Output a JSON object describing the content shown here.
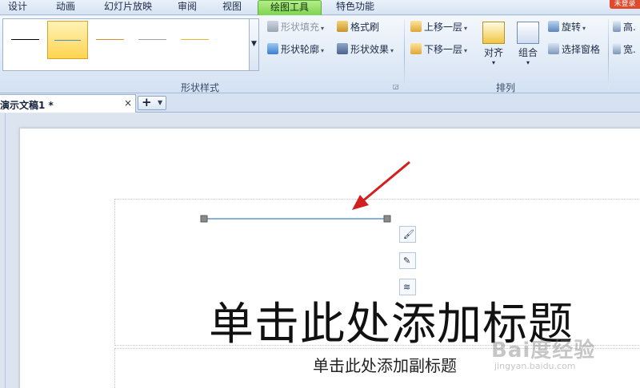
{
  "menu_tabs": [
    {
      "label": "设计",
      "active": false
    },
    {
      "label": "动画",
      "active": false
    },
    {
      "label": "幻灯片放映",
      "active": false
    },
    {
      "label": "审阅",
      "active": false
    },
    {
      "label": "视图",
      "active": false
    },
    {
      "label": "绘图工具",
      "active": true
    },
    {
      "label": "特色功能",
      "active": false
    }
  ],
  "corner_badge": "未登录",
  "shape_styles": {
    "swatch_colors": [
      "#000000",
      "#4f8fc6",
      "#d99137",
      "#9aa0a8",
      "#e8b938"
    ],
    "group_label": "形状样式",
    "fill_label": "形状填充",
    "outline_label": "形状轮廓",
    "format_painter_label": "格式刷",
    "effect_label": "形状效果"
  },
  "arrange": {
    "bring_forward_label": "上移一层",
    "send_backward_label": "下移一层",
    "align_label": "对齐",
    "group_label": "组合",
    "rotate_label": "旋转",
    "selection_pane_label": "选择窗格",
    "section_label": "排列"
  },
  "size": {
    "height_label": "高",
    "width_label": "宽"
  },
  "document_tab": {
    "title": "演示文稿1 *",
    "close_glyph": "×"
  },
  "slide": {
    "title_placeholder": "单击此处添加标题",
    "subtitle_placeholder": "单击此处添加副标题"
  },
  "watermark": {
    "main": "Bai度经验",
    "sub": "jingyan.baidu.com"
  },
  "colors": {
    "accent_tab": "#7ed54f",
    "selection_handle": "#8a8a8a",
    "annotation_arrow": "#d21f1f",
    "line_color": "#8ab2d6"
  }
}
